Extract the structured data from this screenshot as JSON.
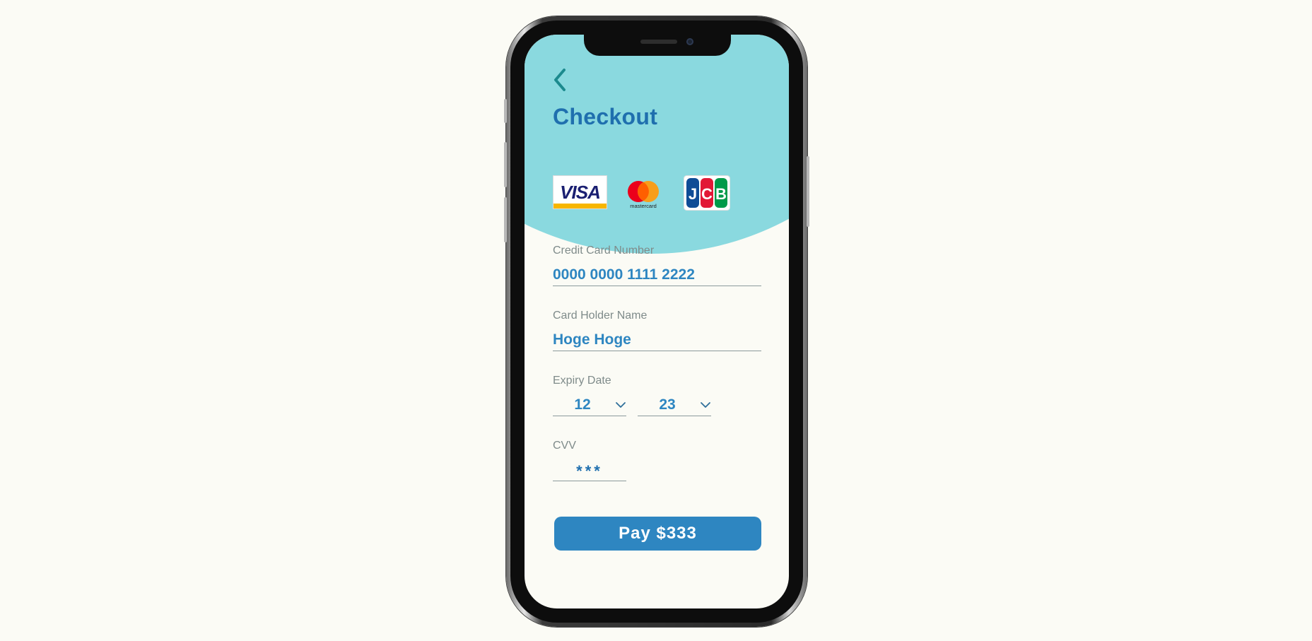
{
  "colors": {
    "accent": "#2e86c1",
    "header_bg": "#8ad9df",
    "title": "#1f6fae",
    "back_arrow": "#1c8a8e",
    "label": "#7f8b8a",
    "page_bg": "#fbfbf5"
  },
  "header": {
    "back_icon": "chevron-left-icon",
    "title": "Checkout"
  },
  "payment_methods": {
    "visa": "VISA",
    "mastercard": "mastercard",
    "jcb": [
      "J",
      "C",
      "B"
    ]
  },
  "form": {
    "card_number": {
      "label": "Credit Card Number",
      "value": "0000 0000 1111 2222"
    },
    "holder_name": {
      "label": "Card Holder Name",
      "value": "Hoge Hoge"
    },
    "expiry": {
      "label": "Expiry Date",
      "month": "12",
      "year": "23",
      "icon": "chevron-down-icon"
    },
    "cvv": {
      "label": "CVV",
      "value": "***"
    }
  },
  "pay_button": {
    "label": "Pay $333"
  }
}
